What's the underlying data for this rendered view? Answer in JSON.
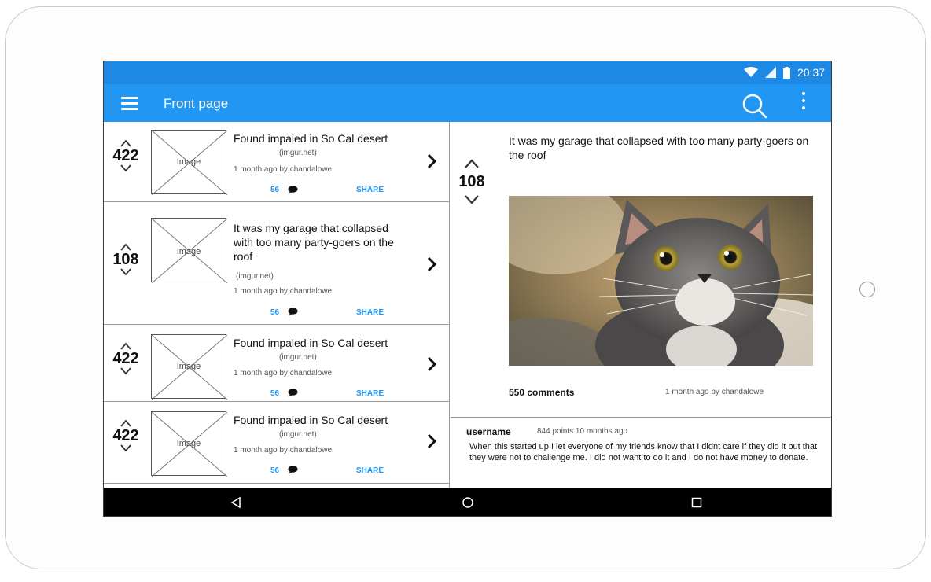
{
  "status": {
    "time": "20:37"
  },
  "appbar": {
    "title": "Front page"
  },
  "posts": [
    {
      "score": "422",
      "thumb_label": "Image",
      "title": "Found impaled in So Cal desert",
      "domain": "(imgur.net)",
      "meta": "1 month ago by chandalowe",
      "comments": "56",
      "share": "SHARE"
    },
    {
      "score": "108",
      "thumb_label": "Image",
      "title": "It was my garage that collapsed with too many party-goers on the roof",
      "domain": "(imgur.net)",
      "meta": "1 month ago by chandalowe",
      "comments": "56",
      "share": "SHARE"
    },
    {
      "score": "422",
      "thumb_label": "Image",
      "title": "Found impaled in So Cal desert",
      "domain": "(imgur.net)",
      "meta": "1 month ago by chandalowe",
      "comments": "56",
      "share": "SHARE"
    },
    {
      "score": "422",
      "thumb_label": "Image",
      "title": "Found impaled in So Cal desert",
      "domain": "(imgur.net)",
      "meta": "1 month ago by chandalowe",
      "comments": "56",
      "share": "SHARE"
    }
  ],
  "detail": {
    "score": "108",
    "title": "It was my garage that collapsed with too many party-goers on the roof",
    "comments_label": "550 comments",
    "meta": "1 month ago by chandalowe",
    "comment": {
      "username": "username",
      "points": "844 points 10 months ago",
      "body": "When this started up I let everyone of my friends know that I didnt care if they did it but that they were not to challenge me. I did not want to do it and I do not have money to donate."
    }
  },
  "icons": {
    "menu": "menu-icon",
    "search": "search-icon",
    "more": "more-vert-icon",
    "vote_up": "chevron-up-icon",
    "vote_down": "chevron-down-icon",
    "open": "chevron-right-icon",
    "comments": "speech-bubble-icon",
    "nav_back": "back-triangle-icon",
    "nav_home": "home-circle-icon",
    "nav_recents": "recents-square-icon"
  },
  "colors": {
    "status_bar": "#1e88e5",
    "app_bar": "#2196f3",
    "link": "#2196f3",
    "nav_bar": "#000000"
  }
}
